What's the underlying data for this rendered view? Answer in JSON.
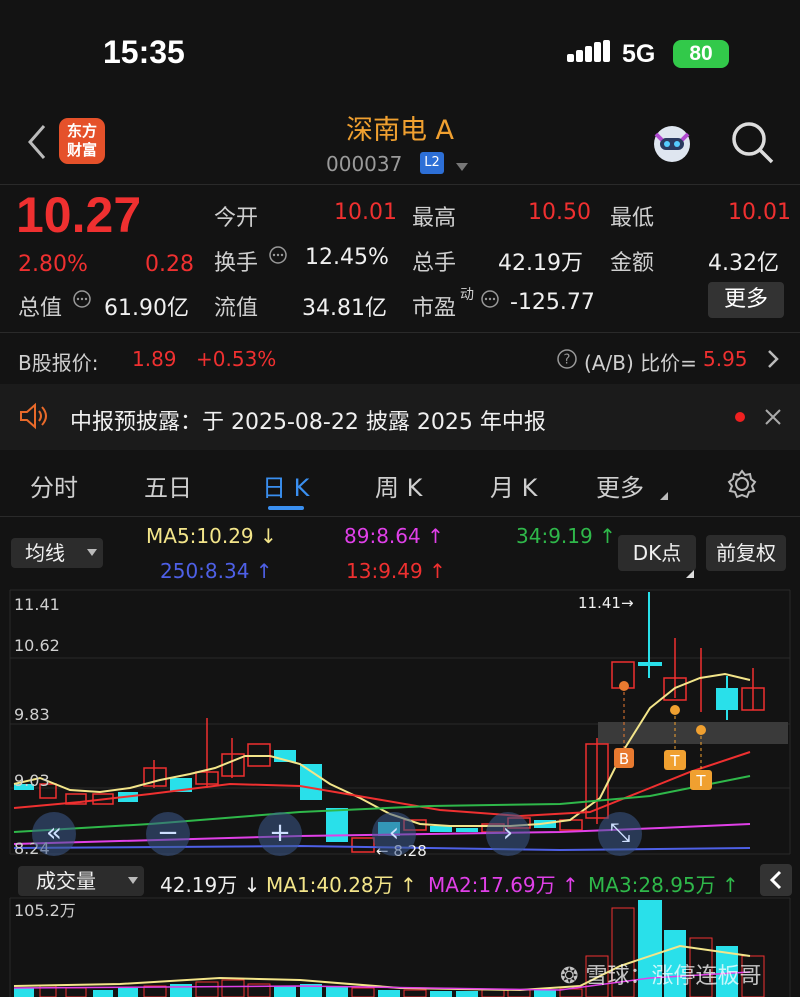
{
  "status": {
    "time": "15:35",
    "network": "5G",
    "battery": "80"
  },
  "header": {
    "title": "深南电 A",
    "code": "000037",
    "badge": "L2",
    "logo_line1": "东方",
    "logo_line2": "财富"
  },
  "quote": {
    "price": "10.27",
    "change_pct": "2.80%",
    "change": "0.28",
    "open_label": "今开",
    "open": "10.01",
    "high_label": "最高",
    "high": "10.50",
    "low_label": "最低",
    "low": "10.01",
    "turnover_label": "换手",
    "turnover": "12.45%",
    "volume_label": "总手",
    "volume": "42.19万",
    "amount_label": "金额",
    "amount": "4.32亿",
    "mcap_label": "总值",
    "mcap": "61.90亿",
    "float_label": "流值",
    "float": "34.81亿",
    "pe_label": "市盈",
    "pe_sup": "动",
    "pe": "-125.77",
    "more": "更多"
  },
  "bshare": {
    "label": "B股报价:",
    "price": "1.89",
    "pct": "+0.53%",
    "ratio_label": "(A/B) 比价=",
    "ratio": "5.95"
  },
  "notice": {
    "text": "中报预披露：于 2025-08-22 披露 2025 年中报"
  },
  "tabs": [
    "分时",
    "五日",
    "日 K",
    "周 K",
    "月 K",
    "更多"
  ],
  "indicators": {
    "dropdown": "均线",
    "ma5": "MA5:10.29 ↓",
    "ma89": "89:8.64 ↑",
    "ma34": "34:9.19 ↑",
    "ma250": "250:8.34 ↑",
    "ma13": "13:9.49 ↑",
    "dk_btn": "DK点",
    "adj_btn": "前复权"
  },
  "kline": {
    "y_labels": [
      "11.41",
      "10.62",
      "9.83",
      "9.03",
      "8.24"
    ],
    "max_label": "11.41→",
    "min_label": "← 8.28",
    "markers": [
      "B",
      "T",
      "T"
    ]
  },
  "volume_bar": {
    "dropdown": "成交量",
    "vol": "42.19万 ↓",
    "ma1": "MA1:40.28万 ↑",
    "ma2": "MA2:17.69万 ↑",
    "ma3": "MA3:28.95万 ↑",
    "max": "105.2万"
  },
  "watermark": "雪球：涨停连板哥",
  "colors": {
    "up": "#ef3030",
    "down": "#29e0ea",
    "accent": "#3a8ff0",
    "brand": "#f0a030"
  }
}
